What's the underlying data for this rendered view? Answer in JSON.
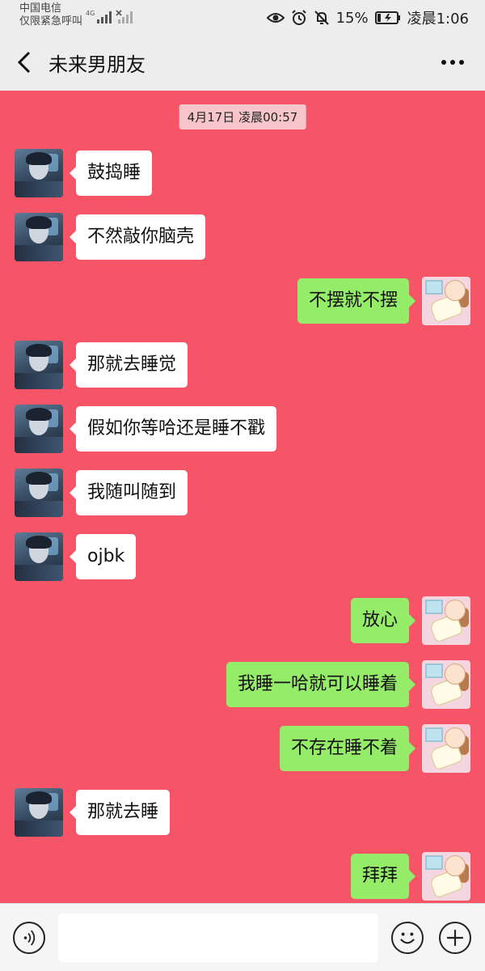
{
  "status_bar": {
    "carrier": "中国电信",
    "carrier_sub": "仅限紧急呼叫",
    "network": "4G",
    "battery": "15%",
    "time": "凌晨1:06"
  },
  "header": {
    "title": "未来男朋友",
    "back_icon": "chevron-left-icon",
    "more_icon": "more-horizontal-icon"
  },
  "chat": {
    "timestamp": "4月17日 凌晨00:57",
    "messages": [
      {
        "side": "left",
        "text": "鼓捣睡"
      },
      {
        "side": "left",
        "text": "不然敲你脑壳"
      },
      {
        "side": "right",
        "text": "不摆就不摆"
      },
      {
        "side": "left",
        "text": "那就去睡觉"
      },
      {
        "side": "left",
        "text": "假如你等哈还是睡不戳"
      },
      {
        "side": "left",
        "text": "我随叫随到"
      },
      {
        "side": "left",
        "text": "ojbk"
      },
      {
        "side": "right",
        "text": "放心"
      },
      {
        "side": "right",
        "text": "我睡一哈就可以睡着"
      },
      {
        "side": "right",
        "text": "不存在睡不着"
      },
      {
        "side": "left",
        "text": "那就去睡"
      },
      {
        "side": "right",
        "text": "拜拜"
      }
    ]
  },
  "input_bar": {
    "text_value": "",
    "voice_icon": "voice-icon",
    "emoji_icon": "emoji-icon",
    "plus_icon": "plus-icon"
  },
  "colors": {
    "chat_background": "#f65568",
    "sent_bubble": "#95ec69",
    "received_bubble": "#ffffff",
    "timestamp_bg": "#f7c5c9"
  }
}
